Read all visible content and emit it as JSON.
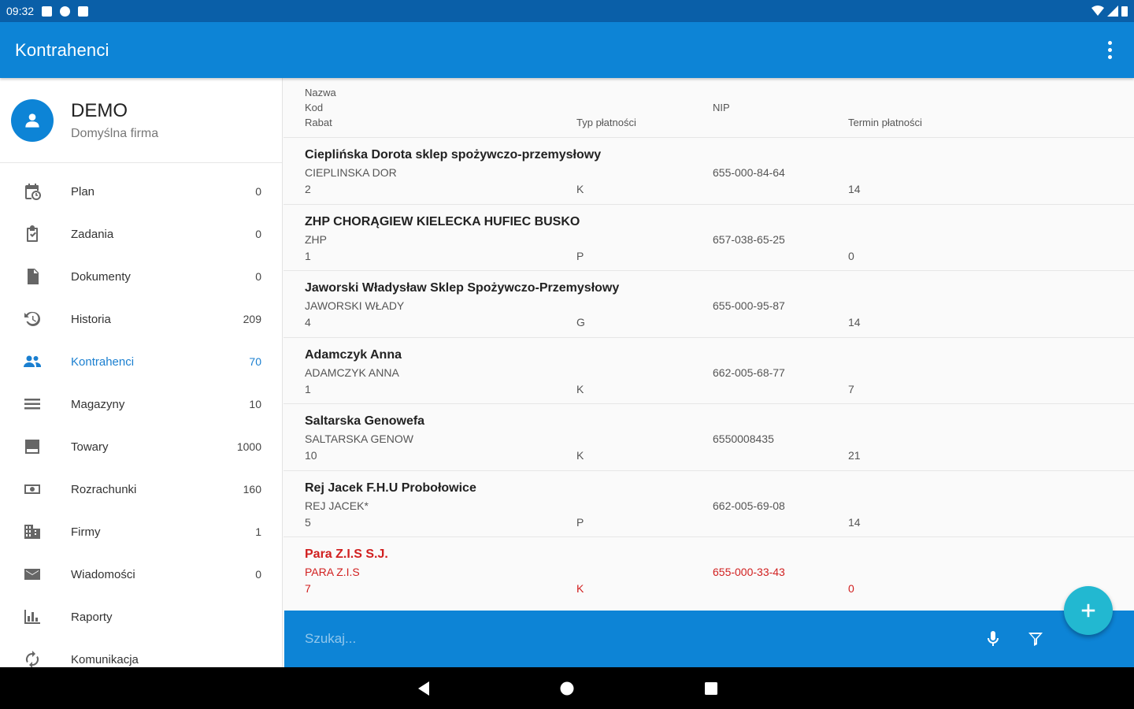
{
  "status_bar": {
    "time": "09:32"
  },
  "app_bar": {
    "title": "Kontrahenci"
  },
  "profile": {
    "name": "DEMO",
    "subtitle": "Domyślna firma"
  },
  "nav": [
    {
      "label": "Plan",
      "count": "0",
      "icon": "calendar-clock-icon"
    },
    {
      "label": "Zadania",
      "count": "0",
      "icon": "clipboard-check-icon"
    },
    {
      "label": "Dokumenty",
      "count": "0",
      "icon": "document-icon"
    },
    {
      "label": "Historia",
      "count": "209",
      "icon": "history-icon"
    },
    {
      "label": "Kontrahenci",
      "count": "70",
      "icon": "people-icon",
      "active": true
    },
    {
      "label": "Magazyny",
      "count": "10",
      "icon": "list-icon"
    },
    {
      "label": "Towary",
      "count": "1000",
      "icon": "product-icon"
    },
    {
      "label": "Rozrachunki",
      "count": "160",
      "icon": "money-icon"
    },
    {
      "label": "Firmy",
      "count": "1",
      "icon": "building-icon"
    },
    {
      "label": "Wiadomości",
      "count": "0",
      "icon": "mail-icon"
    },
    {
      "label": "Raporty",
      "count": "",
      "icon": "bar-chart-icon"
    },
    {
      "label": "Komunikacja",
      "count": "",
      "icon": "sync-icon"
    }
  ],
  "table": {
    "headers": {
      "nazwa": "Nazwa",
      "kod": "Kod",
      "rabat": "Rabat",
      "typ": "Typ płatności",
      "nip": "NIP",
      "termin": "Termin płatności"
    },
    "rows": [
      {
        "name": "Cieplińska  Dorota sklep spożywczo-przemysłowy",
        "code": "CIEPLINSKA  DOR",
        "rabat": "2",
        "typ": "K",
        "nip": "655-000-84-64",
        "termin": "14"
      },
      {
        "name": "ZHP CHORĄGIEW KIELECKA HUFIEC BUSKO",
        "code": "ZHP",
        "rabat": "1",
        "typ": "P",
        "nip": "657-038-65-25",
        "termin": "0"
      },
      {
        "name": "Jaworski  Władysław  Sklep Spożywczo-Przemysłowy",
        "code": "JAWORSKI  WŁADY",
        "rabat": "4",
        "typ": "G",
        "nip": "655-000-95-87",
        "termin": "14"
      },
      {
        "name": "Adamczyk  Anna",
        "code": "ADAMCZYK  ANNA",
        "rabat": "1",
        "typ": "K",
        "nip": "662-005-68-77",
        "termin": "7"
      },
      {
        "name": "Saltarska Genowefa",
        "code": "SALTARSKA GENOW",
        "rabat": "10",
        "typ": "K",
        "nip": "6550008435",
        "termin": "21"
      },
      {
        "name": "Rej Jacek F.H.U  Probołowice",
        "code": "REJ JACEK*",
        "rabat": "5",
        "typ": "P",
        "nip": "662-005-69-08",
        "termin": "14"
      },
      {
        "name": "Para  Z.I.S    S.J.",
        "code": "PARA  Z.I.S",
        "rabat": "7",
        "typ": "K",
        "nip": "655-000-33-43",
        "termin": "0",
        "highlight": true
      }
    ]
  },
  "search": {
    "placeholder": "Szukaj..."
  },
  "colors": {
    "primary": "#0d84d6",
    "status_bar": "#0a5fa8",
    "fab": "#22b8d1",
    "highlight_red": "#d11f1f",
    "active_nav": "#1a7fd0"
  }
}
